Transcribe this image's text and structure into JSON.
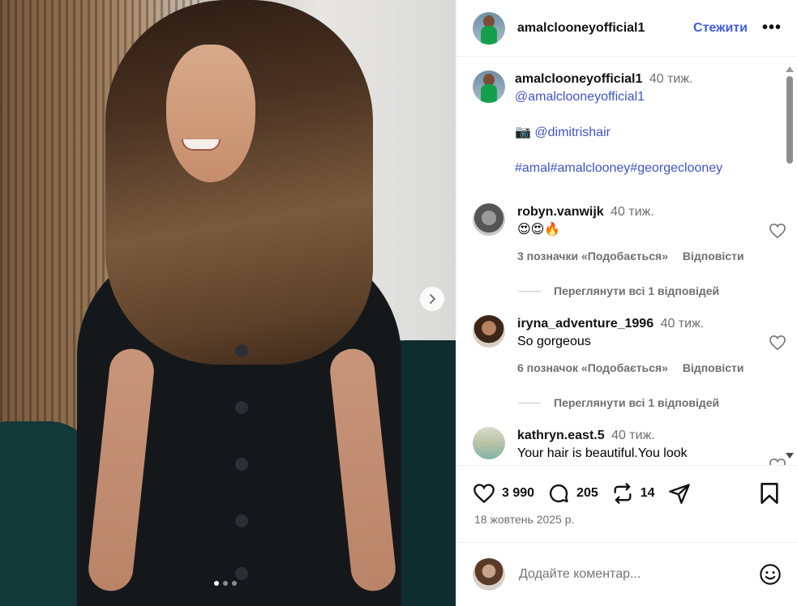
{
  "post": {
    "username": "amalclooneyofficial1",
    "follow_label": "Стежити",
    "more_label": "•••",
    "caption": {
      "username": "amalclooneyofficial1",
      "time": "40 тиж.",
      "mention": "@amalclooneyofficial1",
      "camera_emoji": "📷",
      "photo_credit": "@dimitrishair",
      "hashtags": "#amal#amalclooney#georgeclooney"
    },
    "carousel": {
      "dots": 3,
      "active_index": 0
    }
  },
  "comments": [
    {
      "username": "robyn.vanwijk",
      "time": "40 тиж.",
      "text": "😍😍🔥",
      "likes_label": "3 позначки «Подобається»",
      "reply_label": "Відповісти",
      "view_replies": "Переглянути всі 1 відповідей"
    },
    {
      "username": "iryna_adventure_1996",
      "time": "40 тиж.",
      "text": "So gorgeous",
      "likes_label": "6 позначок «Подобається»",
      "reply_label": "Відповісти",
      "view_replies": "Переглянути всі 1 відповідей"
    },
    {
      "username": "kathryn.east.5",
      "time": "40 тиж.",
      "text": "Your hair is beautiful.You look"
    }
  ],
  "actions": {
    "likes": "3 990",
    "comments": "205",
    "reposts": "14",
    "date": "18 жовтень 2025 р."
  },
  "add_comment": {
    "placeholder": "Додайте коментар..."
  },
  "colors": {
    "link": "#3f55c9",
    "follow": "#3f5ce4",
    "muted": "#6f6f6f"
  },
  "icons": [
    "next-arrow-icon",
    "heart-icon",
    "comment-icon",
    "repost-icon",
    "share-icon",
    "bookmark-icon",
    "emoji-icon"
  ]
}
